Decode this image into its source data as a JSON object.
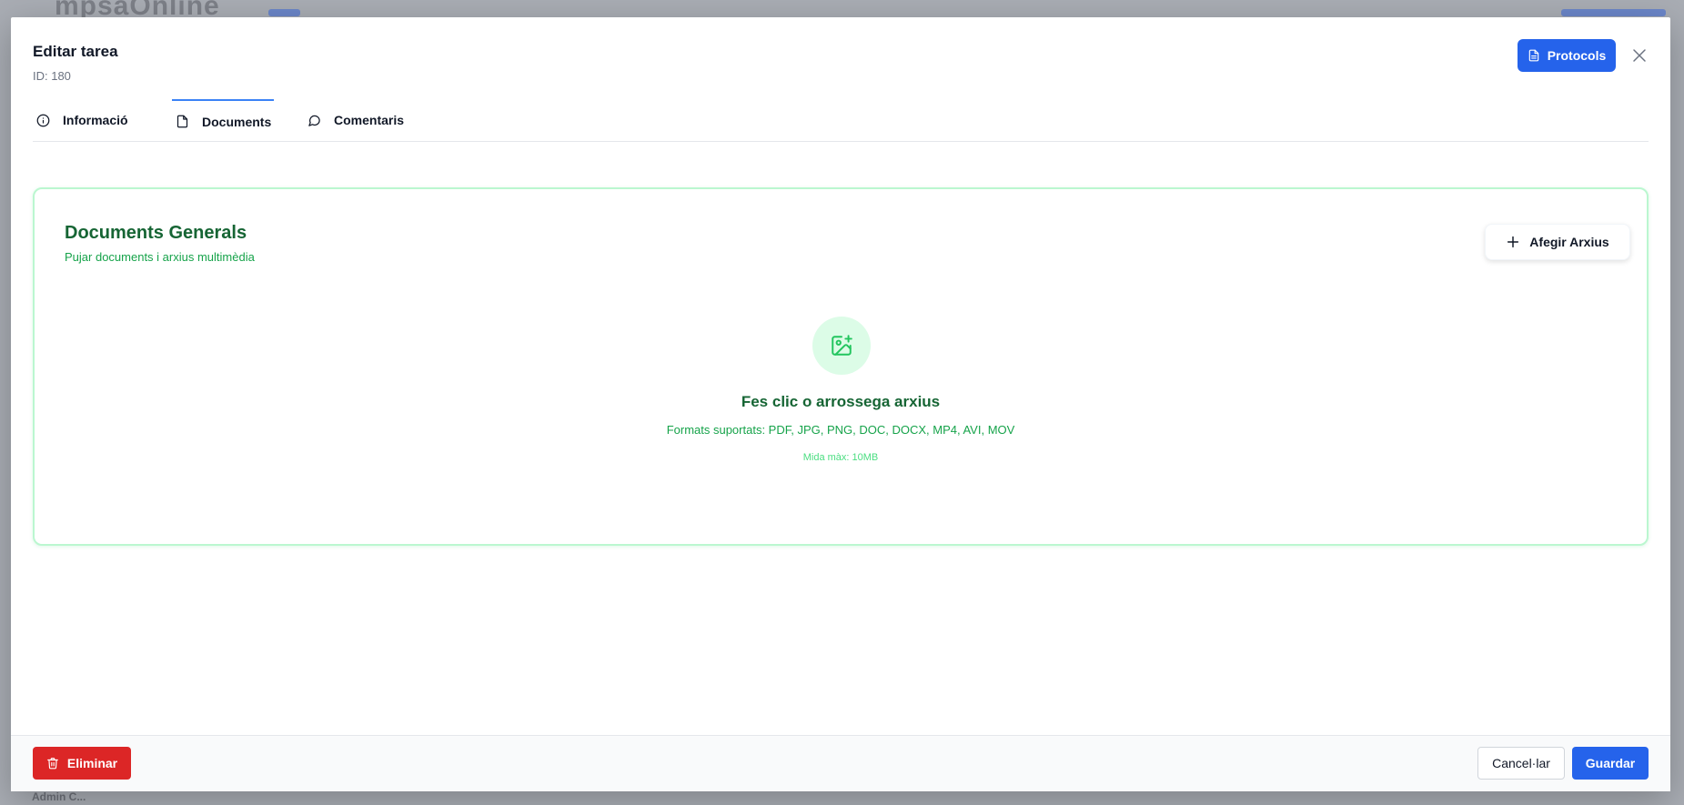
{
  "background": {
    "logo_text": "mpsaOnline",
    "footer_user": "Admin C..."
  },
  "modal": {
    "title": "Editar tarea",
    "id_label": "ID: 180",
    "protocols_label": "Protocols",
    "tabs": [
      {
        "label": "Informació",
        "icon": "info-icon",
        "active": false
      },
      {
        "label": "Documents",
        "icon": "file-icon",
        "active": true
      },
      {
        "label": "Comentaris",
        "icon": "message-circle-icon",
        "active": false
      }
    ]
  },
  "documents": {
    "title": "Documents Generals",
    "subtitle": "Pujar documents i arxius multimèdia",
    "add_label": "Afegir Arxius",
    "drop_title": "Fes clic o arrossega arxius",
    "formats": "Formats suportats: PDF, JPG, PNG, DOC, DOCX, MP4, AVI, MOV",
    "max_size": "Mida màx: 10MB"
  },
  "footer": {
    "delete_label": "Eliminar",
    "cancel_label": "Cancel·lar",
    "save_label": "Guardar"
  },
  "colors": {
    "primary": "#2563eb",
    "danger": "#dc2626",
    "green_title": "#166534",
    "green_text": "#16a34a",
    "green_border": "#bbf7d0"
  }
}
